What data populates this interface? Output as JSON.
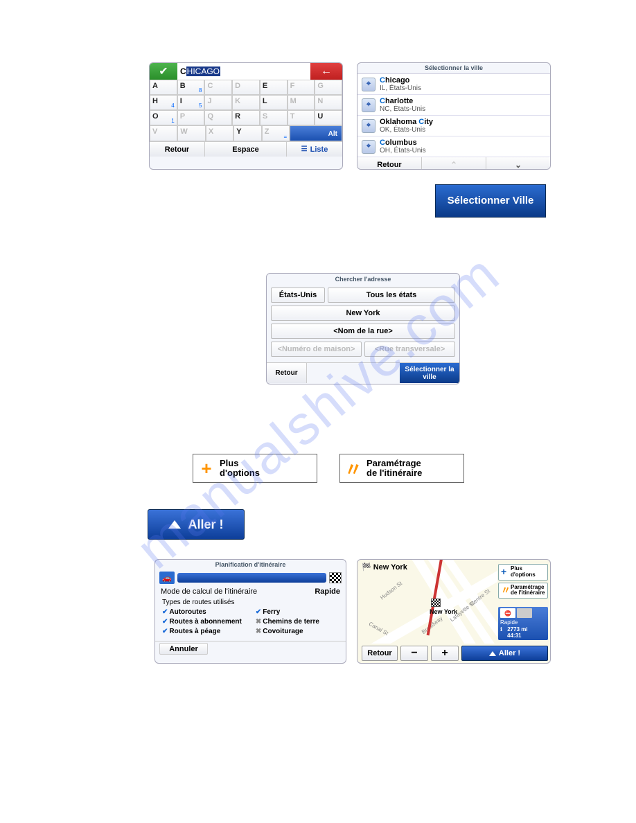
{
  "keyboard": {
    "prefix": "C",
    "selected": "HICAGO",
    "rows": [
      [
        {
          "l": "A",
          "s": "",
          "en": true
        },
        {
          "l": "B",
          "s": "8",
          "en": true
        },
        {
          "l": "C",
          "s": "",
          "en": false
        },
        {
          "l": "D",
          "s": "",
          "en": false
        },
        {
          "l": "E",
          "s": "",
          "en": true
        },
        {
          "l": "F",
          "s": "",
          "en": false
        },
        {
          "l": "G",
          "s": "",
          "en": false
        }
      ],
      [
        {
          "l": "H",
          "s": "4",
          "en": true
        },
        {
          "l": "I",
          "s": "5",
          "en": true
        },
        {
          "l": "J",
          "s": "",
          "en": false
        },
        {
          "l": "K",
          "s": "",
          "en": false
        },
        {
          "l": "L",
          "s": "",
          "en": true
        },
        {
          "l": "M",
          "s": "",
          "en": false
        },
        {
          "l": "N",
          "s": "",
          "en": false
        }
      ],
      [
        {
          "l": "O",
          "s": "1",
          "en": true
        },
        {
          "l": "P",
          "s": "",
          "en": false
        },
        {
          "l": "Q",
          "s": "",
          "en": false
        },
        {
          "l": "R",
          "s": "",
          "en": true
        },
        {
          "l": "S",
          "s": "",
          "en": false
        },
        {
          "l": "T",
          "s": "",
          "en": false
        },
        {
          "l": "U",
          "s": "",
          "en": true
        }
      ],
      [
        {
          "l": "V",
          "s": "",
          "en": false
        },
        {
          "l": "W",
          "s": "",
          "en": false
        },
        {
          "l": "X",
          "s": "",
          "en": false
        },
        {
          "l": "Y",
          "s": "",
          "en": true
        },
        {
          "l": "Z",
          "s": "=",
          "en": false
        },
        {
          "l": "",
          "s": "",
          "en": false,
          "alt": true,
          "altLabel": "Alt"
        }
      ]
    ],
    "retour": "Retour",
    "espace": "Espace",
    "liste": "Liste"
  },
  "citylist": {
    "title": "Sélectionner la ville",
    "items": [
      {
        "name": "Chicago",
        "highlight": "C",
        "rest": "hicago",
        "sub": "IL, États-Unis"
      },
      {
        "name": "Charlotte",
        "highlight": "C",
        "rest": "harlotte",
        "sub": "NC, États-Unis"
      },
      {
        "name": "Oklahoma City",
        "highlight": "C",
        "pre": "Oklahoma ",
        "rest": "ity",
        "sub": "OK, États-Unis"
      },
      {
        "name": "Columbus",
        "highlight": "C",
        "rest": "olumbus",
        "sub": "OH, États-Unis"
      }
    ],
    "retour": "Retour"
  },
  "selectVilleBtn": "Sélectionner Ville",
  "addr": {
    "title": "Chercher l'adresse",
    "country": "États-Unis",
    "allStates": "Tous les états",
    "city": "New York",
    "street": "<Nom de la rue>",
    "houseNo": "<Numéro de maison>",
    "cross": "<Rue transversale>",
    "retour": "Retour",
    "select": "Sélectionner la ville"
  },
  "moreOptions": {
    "l1": "Plus",
    "l2": "d'options"
  },
  "routeParam": {
    "l1": "Paramétrage",
    "l2": "de l'itinéraire"
  },
  "aller": "Aller !",
  "planif": {
    "title": "Planification d'itinéraire",
    "modeLabel": "Mode de calcul de l'itinéraire",
    "modeValue": "Rapide",
    "typesTitle": "Types de routes utilisés",
    "col1": [
      "Autoroutes",
      "Routes à abonnement",
      "Routes à péage"
    ],
    "col2": [
      "Ferry",
      "Chemins de terre",
      "Covoiturage"
    ],
    "col2On": [
      true,
      false,
      false
    ],
    "annuler": "Annuler"
  },
  "map": {
    "title": "New York",
    "moreOptions": {
      "l1": "Plus",
      "l2": "d'options"
    },
    "routeParam": {
      "l1": "Paramétrage",
      "l2": "de l'itinéraire"
    },
    "mode": "Rapide",
    "dist": "2773 mi",
    "time": "44:31",
    "retour": "Retour",
    "aller": "Aller !",
    "destLabel": "New York",
    "streets": [
      "Hudson St",
      "Broadway",
      "Lafayette St",
      "Centre St",
      "Canal St"
    ]
  }
}
